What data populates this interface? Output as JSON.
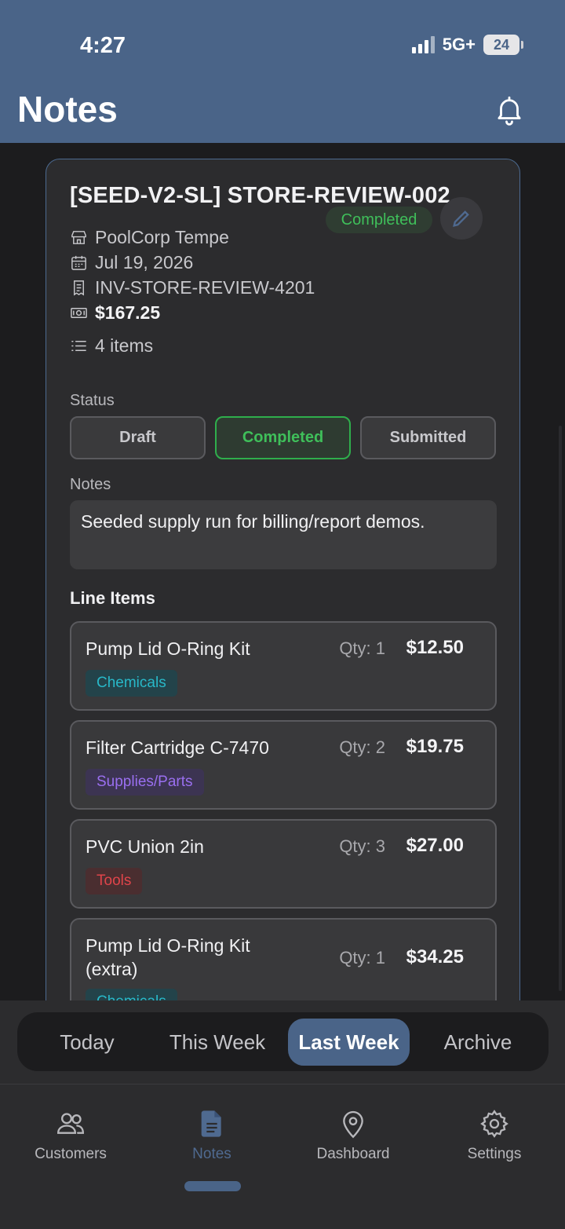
{
  "status_bar": {
    "time": "4:27",
    "network": "5G+",
    "battery": "24"
  },
  "header": {
    "title": "Notes",
    "bell_icon": "bell-icon"
  },
  "note": {
    "title": "[SEED-V2-SL] STORE-REVIEW-002",
    "status_badge": "Completed",
    "store": "PoolCorp Tempe",
    "date": "Jul 19, 2026",
    "invoice": "INV-STORE-REVIEW-4201",
    "amount": "$167.25",
    "items_count": "4 items",
    "status_label": "Status",
    "status_options": [
      "Draft",
      "Completed",
      "Submitted"
    ],
    "selected_status": "Completed",
    "notes_label": "Notes",
    "notes_text": "Seeded supply run for billing/report demos.",
    "line_items_title": "Line Items",
    "line_items": [
      {
        "name": "Pump Lid O-Ring Kit",
        "qty": "Qty: 1",
        "price": "$12.50",
        "category": "Chemicals"
      },
      {
        "name": "Filter Cartridge C-7470",
        "qty": "Qty: 2",
        "price": "$19.75",
        "category": "Supplies/Parts"
      },
      {
        "name": "PVC Union 2in",
        "qty": "Qty: 3",
        "price": "$27.00",
        "category": "Tools"
      },
      {
        "name": "Pump Lid O-Ring Kit (extra)",
        "qty": "Qty: 1",
        "price": "$34.25",
        "category": "Chemicals"
      }
    ]
  },
  "segments": {
    "items": [
      "Today",
      "This Week",
      "Last Week",
      "Archive"
    ],
    "selected": "Last Week"
  },
  "tabbar": {
    "items": [
      {
        "label": "Customers",
        "icon": "users-icon"
      },
      {
        "label": "Notes",
        "icon": "document-icon"
      },
      {
        "label": "Dashboard",
        "icon": "map-pin-icon"
      },
      {
        "label": "Settings",
        "icon": "gear-icon"
      }
    ],
    "selected": "Notes"
  },
  "colors": {
    "accent": "#4a6488",
    "success": "#3fbf5a",
    "chemicals": "#28b8c8",
    "supplies": "#9a6ff0",
    "tools": "#e0444a"
  }
}
